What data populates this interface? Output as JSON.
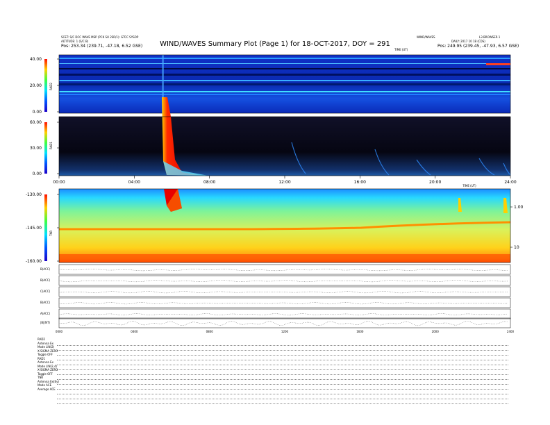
{
  "header": {
    "left_line1": "SCET: S/C DCC WAVE MSP (PCK SU 2SR/1): GTCC SYSOP",
    "left_line2": "ALTITUDE: 1 (S/C B)",
    "left_pos": "Pos:    253.34 (239.71, -47.18, 6.52 GSE)",
    "center_top": "WIND/WAVES",
    "right_top": "L3 BROWSER 1",
    "right_line2": "DAILY: 2017 10 18 (CDS)",
    "right_pos": "Pos:    249.95 (239.45, -47.93, 6.57 GSE)",
    "tinystamp": "TIME (UT)"
  },
  "title": "WIND/WAVES Summary Plot (Page 1) for 18-OCT-2017, DOY = 291",
  "panels": {
    "rad2": {
      "label": "RAD2",
      "ticks": [
        "40.00",
        "20.00",
        "0.00"
      ]
    },
    "rad1": {
      "label": "RAD1",
      "ticks": [
        "60.00",
        "30.00",
        "0.00"
      ]
    },
    "tnr": {
      "label": "TNR",
      "ticks": [
        "-130.00",
        "-145.00",
        "-160.00"
      ],
      "right_ticks": [
        "1.00",
        "10"
      ]
    }
  },
  "time_ticks": [
    "00:00",
    "04:00",
    "08:00",
    "12:00",
    "16:00",
    "20:00",
    "24:00"
  ],
  "time_ticks_small": [
    "0000",
    "0400",
    "0800",
    "1200",
    "1600",
    "2000",
    "2400"
  ],
  "line_panels": [
    {
      "label": "B(ACC)"
    },
    {
      "label": "B(ACC)"
    },
    {
      "label": "C(ACC)"
    },
    {
      "label": "B(ACC)"
    },
    {
      "label": "A(ACC)"
    },
    {
      "label": "|B|(NT)"
    }
  ],
  "bottom_table": {
    "rows": [
      "RAD2",
      "Antenna    Ex",
      "Mode    LIN(2)",
      "X-SIGMA  ZERO",
      "Toggle    OFF",
      "RAD1",
      "Antenna    Ex",
      "Mode   LIN(2,4)",
      "X-SIGMA  ZERO",
      "Toggle    OFF",
      "TNR",
      "Antenna  Ex(Ey)",
      "Mode     ACE",
      "Average  ACE"
    ]
  },
  "chart_data": {
    "type": "heatmap",
    "title": "WIND/WAVES Summary Plot (Page 1) for 18-OCT-2017, DOY = 291",
    "x": {
      "label": "",
      "range_hours": [
        0,
        24
      ],
      "ticks": [
        "00:00",
        "04:00",
        "08:00",
        "12:00",
        "16:00",
        "20:00",
        "24:00"
      ]
    },
    "panels": [
      {
        "name": "RAD2",
        "ylim": [
          0,
          40
        ],
        "ylabel": "RAD2"
      },
      {
        "name": "RAD1",
        "ylim": [
          0,
          60
        ],
        "ylabel": "RAD1"
      },
      {
        "name": "TNR",
        "ylim": [
          -160,
          -130
        ],
        "ylabel": "TNR"
      }
    ],
    "events": [
      {
        "panel": "RAD1",
        "hour_start": 5.5,
        "hour_end": 6.3,
        "intensity": "high"
      },
      {
        "panel": "TNR",
        "hour_start": 5.6,
        "hour_end": 6.4,
        "intensity": "high"
      }
    ]
  }
}
